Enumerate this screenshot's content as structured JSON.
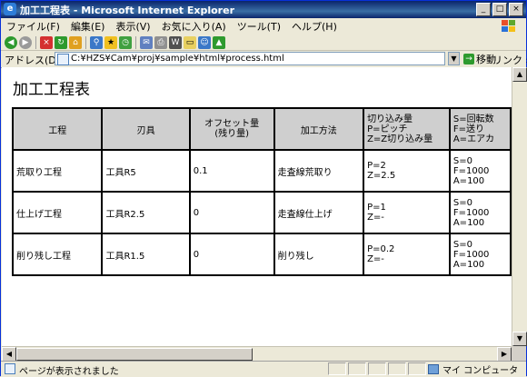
{
  "window": {
    "title": "加工工程表 - Microsoft Internet Explorer",
    "controls": {
      "minimize": "_",
      "maximize": "□",
      "close": "×"
    }
  },
  "menu": [
    "ファイル(F)",
    "編集(E)",
    "表示(V)",
    "お気に入り(A)",
    "ツール(T)",
    "ヘルプ(H)"
  ],
  "toolbar": {
    "icons": [
      "back-icon",
      "forward-icon",
      "stop-icon",
      "refresh-icon",
      "home-icon",
      "search-icon",
      "favorites-icon",
      "history-icon",
      "mail-icon",
      "print-icon",
      "edit-icon",
      "discuss-icon",
      "messenger-icon",
      "research-icon"
    ]
  },
  "address": {
    "label": "アドレス(D)",
    "url": "C:¥HZS¥Cam¥proj¥sample¥html¥process.html",
    "go_label": "移動",
    "links_label": "リンク",
    "more": "»"
  },
  "page": {
    "title": "加工工程表",
    "table": {
      "headers": [
        "工程",
        "刃具",
        "オフセット量\n(残り量)",
        "加工方法",
        "切り込み量\nP=ピッチ\nZ=Z切り込み量",
        "S=回転数\nF=送り\nA=エアカ"
      ],
      "rows": [
        [
          "荒取り工程",
          "工具R5",
          "0.1",
          "走査線荒取り",
          "P=2\nZ=2.5",
          "S=0\nF=1000\nA=100"
        ],
        [
          "仕上げ工程",
          "工具R2.5",
          "0",
          "走査線仕上げ",
          "P=1\nZ=-",
          "S=0\nF=1000\nA=100"
        ],
        [
          "削り残し工程",
          "工具R1.5",
          "0",
          "削り残し",
          "P=0.2\nZ=-",
          "S=0\nF=1000\nA=100"
        ]
      ]
    }
  },
  "status": {
    "text": "ページが表示されました",
    "zone": "マイ コンピュータ"
  }
}
